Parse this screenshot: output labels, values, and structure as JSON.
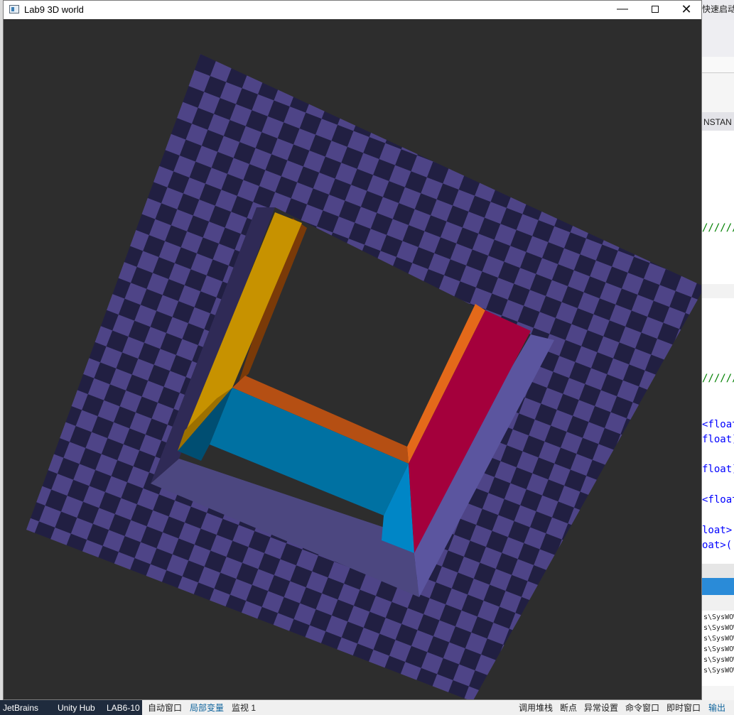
{
  "window": {
    "title": "Lab9 3D world",
    "minimize_glyph": "—",
    "close_glyph": "✕"
  },
  "scene": {
    "background_color": "#2d2d2d",
    "checker_light": "#4e4487",
    "checker_dark": "#211f42",
    "walls": [
      {
        "name": "yellow-wall",
        "color": "#c79200"
      },
      {
        "name": "yellow-wall-edge",
        "color": "#7a3a08"
      },
      {
        "name": "yellow-wall-shadow",
        "color": "#9c7000"
      },
      {
        "name": "teal-wall",
        "color": "#0071a2"
      },
      {
        "name": "teal-wall-shadow",
        "color": "#004e72"
      },
      {
        "name": "orange-wall-top",
        "color": "#b54f13"
      },
      {
        "name": "orange-wall-right",
        "color": "#e4691a"
      },
      {
        "name": "crimson-wall",
        "color": "#a4003c"
      },
      {
        "name": "light-blue-face",
        "color": "#0086c6"
      },
      {
        "name": "frame-left",
        "color": "#2f2a56"
      },
      {
        "name": "frame-bottom",
        "color": "#4c4780"
      },
      {
        "name": "frame-right",
        "color": "#5b559f"
      }
    ]
  },
  "ide": {
    "quick_launch": "快速启动",
    "instance_text": "NSTAN",
    "comment_1": "//////",
    "comment_2": "//////",
    "code_lines": [
      "<float",
      "float]",
      "float]",
      "<float",
      "loat>",
      "oat>(("
    ],
    "output_lines": [
      "s\\SysWOW",
      "s\\SysWOW",
      "s\\SysWOW",
      "s\\SysWOW",
      "s\\SysWOW",
      "s\\SysWOW"
    ]
  },
  "taskbar": {
    "items": [
      "JetBrains",
      "Unity Hub",
      "LAB6-10"
    ]
  },
  "ide_tabs_left": [
    "自动窗口",
    "局部变量",
    "监视 1"
  ],
  "ide_tabs_right": [
    "调用堆栈",
    "断点",
    "异常设置",
    "命令窗口",
    "即时窗口",
    "输出"
  ]
}
